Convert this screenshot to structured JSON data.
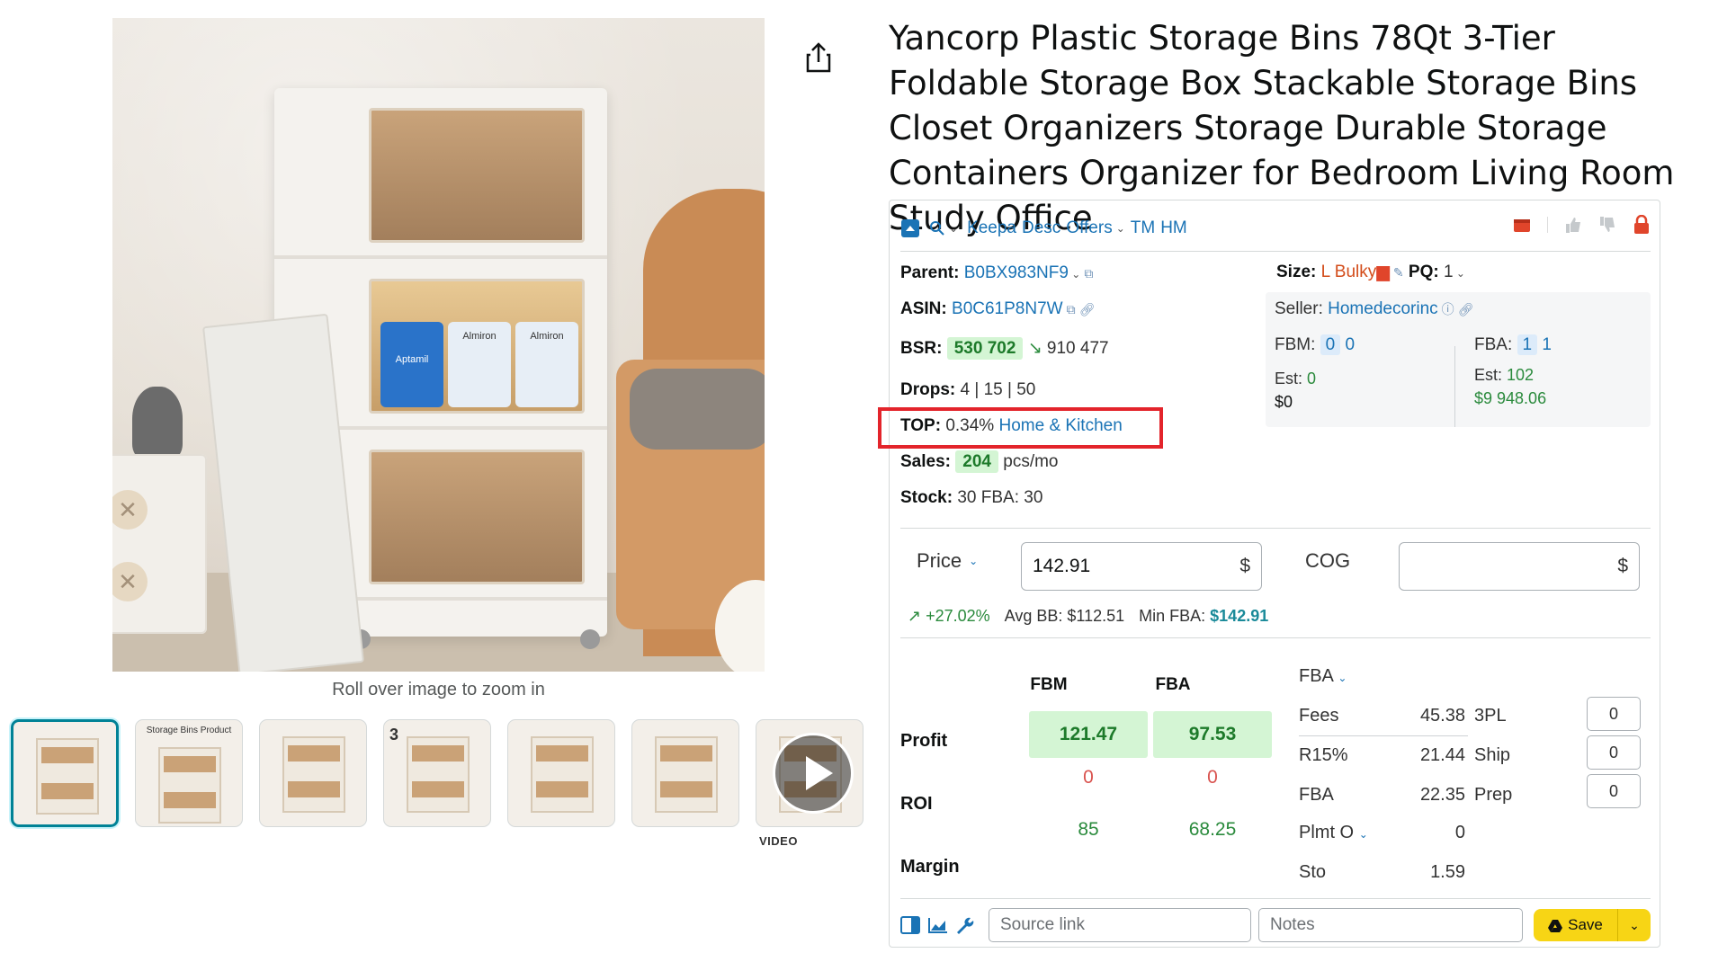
{
  "product": {
    "title": "Yancorp Plastic Storage Bins 78Qt 3-Tier Foldable Storage Box Stackable Storage Bins Closet Organizers Storage Durable Storage Containers Organizer for Bedroom Living Room Study Office",
    "zoom_hint": "Roll over image to zoom in",
    "image_labels": {
      "can_1": "Aptamil",
      "can_2": "Almiron",
      "can_3": "Almiron"
    },
    "thumbnails": [
      {
        "caption": "",
        "selected": true
      },
      {
        "caption": "Storage Bins Product",
        "selected": false
      },
      {
        "caption": "",
        "selected": false
      },
      {
        "caption": "3",
        "selected": false
      },
      {
        "caption": "",
        "selected": false
      },
      {
        "caption": "",
        "selected": false
      },
      {
        "caption": "",
        "selected": false,
        "is_video": true
      }
    ],
    "video_label": "VIDEO",
    "share_icon": "share-icon"
  },
  "keepa": {
    "toolbar": {
      "keepa": "Keepa",
      "desc": "Desc",
      "offers": "Offers",
      "tm": "TM",
      "hm": "HM"
    },
    "parent_label": "Parent:",
    "parent_value": "B0BX983NF9",
    "asin_label": "ASIN:",
    "asin_value": "B0C61P8N7W",
    "bsr_label": "BSR:",
    "bsr_value": "530 702",
    "bsr_prev": "910 477",
    "drops_label": "Drops:",
    "drops_value": "4 | 15 | 50",
    "top_label": "TOP:",
    "top_percent": "0.34%",
    "top_category": "Home & Kitchen",
    "sales_label": "Sales:",
    "sales_value": "204",
    "sales_unit": "pcs/mo",
    "stock_label": "Stock:",
    "stock_value": "30",
    "stock_fba_label": "FBA:",
    "stock_fba_value": "30",
    "size_label": "Size:",
    "size_value": "L Bulky",
    "pq_label": "PQ:",
    "pq_value": "1",
    "seller_label": "Seller:",
    "seller_value": "Homedecorinc",
    "fbm_label": "FBM:",
    "fbm_count_a": "0",
    "fbm_count_b": "0",
    "fba_label": "FBA:",
    "fba_count_a": "1",
    "fba_count_b": "1",
    "est_label": "Est:",
    "fbm_est": "0",
    "fbm_est_money": "$0",
    "fba_est": "102",
    "fba_est_money": "$9 948.06",
    "price_label": "Price",
    "price_value": "142.91",
    "currency": "$",
    "cog_label": "COG",
    "cog_value": "",
    "trend": "+27.02%",
    "avg_bb_label": "Avg BB:",
    "avg_bb_value": "$112.51",
    "min_fba_label": "Min FBA:",
    "min_fba_value": "$142.91",
    "grid": {
      "fbm_head": "FBM",
      "fba_head": "FBA",
      "profit_label": "Profit",
      "roi_label": "ROI",
      "margin_label": "Margin",
      "profit_fbm": "121.47",
      "profit_fba": "97.53",
      "roi_fbm": "0",
      "roi_fba": "0",
      "margin_fbm": "85",
      "margin_fba": "68.25"
    },
    "fees": {
      "mode_label": "FBA",
      "fees_label": "Fees",
      "fees_value": "45.38",
      "r15_label": "R15%",
      "r15_value": "21.44",
      "fba_label": "FBA",
      "fba_value": "22.35",
      "plmt_label": "Plmt O",
      "plmt_value": "0",
      "sto_label": "Sto",
      "sto_value": "1.59",
      "threepl_label": "3PL",
      "threepl_value": "0",
      "ship_label": "Ship",
      "ship_value": "0",
      "prep_label": "Prep",
      "prep_value": "0"
    },
    "source_placeholder": "Source link",
    "notes_placeholder": "Notes",
    "save_label": "Save"
  },
  "colors": {
    "accent_link": "#1a73b5",
    "profit_green": "#1d7a2a",
    "highlight_red": "#e3242b",
    "save_yellow": "#f7d515"
  }
}
